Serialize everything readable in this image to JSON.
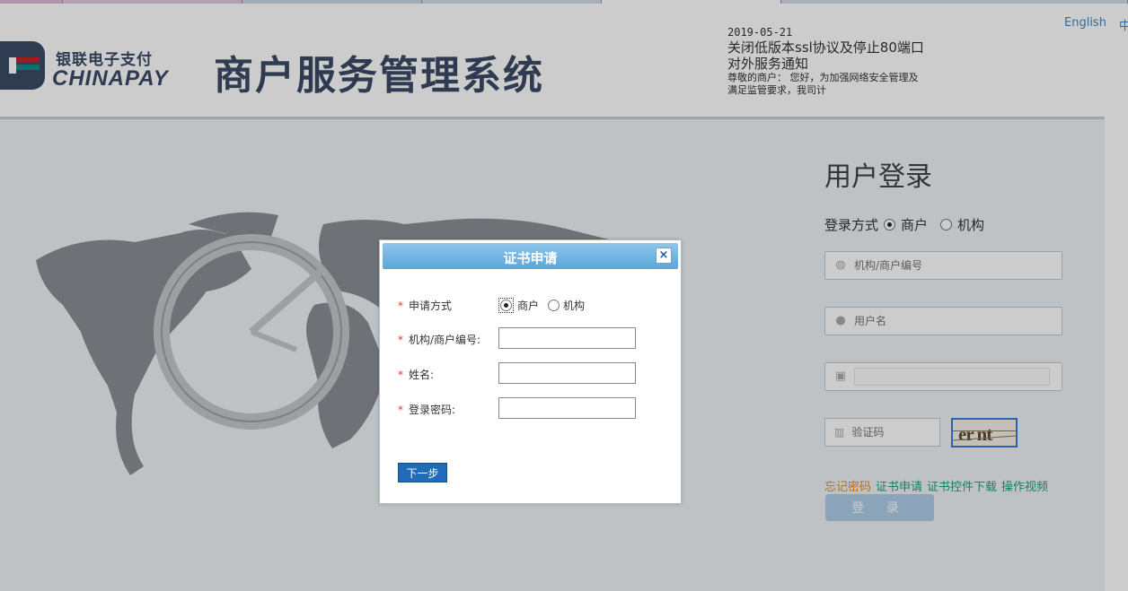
{
  "header": {
    "brand_cn": "银联电子支付",
    "brand_en": "CHINAPAY",
    "system_title": "商户服务管理系统",
    "notice": {
      "date": "2019-05-21",
      "title": "关闭低版本ssl协议及停止80端口对外服务通知",
      "body": "尊敬的商户： 您好，为加强网络安全管理及满足监管要求，我司计"
    },
    "lang_en": "English",
    "lang_cn": "中"
  },
  "login": {
    "title": "用户登录",
    "mode_label": "登录方式",
    "mode_options": [
      "商户",
      "机构"
    ],
    "selected_mode": "商户",
    "org_placeholder": "机构/商户编号",
    "user_placeholder": "用户名",
    "captcha_placeholder": "验证码",
    "captcha_text": "er nt",
    "links": {
      "forgot": "忘记密码",
      "cert_apply": "证书申请",
      "control_download": "证书控件下载",
      "video": "操作视频"
    },
    "submit_label": "登 录"
  },
  "modal": {
    "title": "证书申请",
    "close_label": "×",
    "mode_label": "申请方式",
    "mode_options": [
      "商户",
      "机构"
    ],
    "selected_mode": "商户",
    "org_label": "机构/商户编号:",
    "name_label": "姓名:",
    "password_label": "登录密码:",
    "org_value": "",
    "name_value": "",
    "password_value": "",
    "next_label": "下一步"
  },
  "colors": {
    "brand": "#3a4a66",
    "dialog_header": "#5ba6dc",
    "link_orange": "#e58a1f",
    "link_green": "#1aa37a",
    "required": "#e23a2a"
  }
}
